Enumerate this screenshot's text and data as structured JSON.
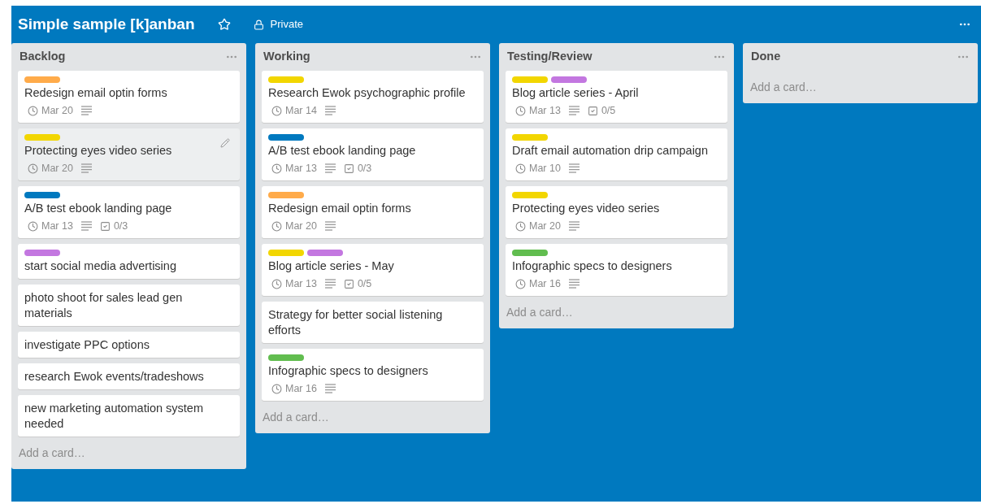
{
  "board": {
    "title": "Simple sample [k]anban",
    "starred": false,
    "visibility": "Private"
  },
  "lists": [
    {
      "name": "Backlog",
      "add_card": "Add a card…",
      "cards": [
        {
          "labels": [
            {
              "color": "#ffab4a"
            }
          ],
          "title": "Redesign email optin forms",
          "due": "Mar 20",
          "description": true,
          "hovered": false
        },
        {
          "labels": [
            {
              "color": "#f2d600"
            }
          ],
          "title": "Protecting eyes video series",
          "due": "Mar 20",
          "description": true,
          "hovered": true
        },
        {
          "labels": [
            {
              "color": "#0079bf"
            }
          ],
          "title": "A/B test ebook landing page",
          "due": "Mar 13",
          "description": true,
          "checklist": "0/3",
          "hovered": false
        },
        {
          "labels": [
            {
              "color": "#c377e0"
            }
          ],
          "title": "start social media advertising",
          "hovered": false
        },
        {
          "title": "photo shoot for sales lead gen materials",
          "hovered": false
        },
        {
          "title": "investigate PPC options",
          "hovered": false
        },
        {
          "title": "research Ewok events/tradeshows",
          "hovered": false
        },
        {
          "title": "new marketing automation system needed",
          "hovered": false
        }
      ]
    },
    {
      "name": "Working",
      "add_card": "Add a card…",
      "cards": [
        {
          "labels": [
            {
              "color": "#f2d600"
            }
          ],
          "title": "Research Ewok psychographic profile",
          "due": "Mar 14",
          "description": true,
          "hovered": false
        },
        {
          "labels": [
            {
              "color": "#0079bf"
            }
          ],
          "title": "A/B test ebook landing page",
          "due": "Mar 13",
          "description": true,
          "checklist": "0/3",
          "hovered": false
        },
        {
          "labels": [
            {
              "color": "#ffab4a"
            }
          ],
          "title": "Redesign email optin forms",
          "due": "Mar 20",
          "description": true,
          "hovered": false
        },
        {
          "labels": [
            {
              "color": "#f2d600"
            },
            {
              "color": "#c377e0"
            }
          ],
          "title": "Blog article series - May",
          "due": "Mar 13",
          "description": true,
          "checklist": "0/5",
          "hovered": false
        },
        {
          "title": "Strategy for better social listening efforts",
          "hovered": false
        },
        {
          "labels": [
            {
              "color": "#61bd4f"
            }
          ],
          "title": "Infographic specs to designers",
          "due": "Mar 16",
          "description": true,
          "hovered": false
        }
      ]
    },
    {
      "name": "Testing/Review",
      "add_card": "Add a card…",
      "cards": [
        {
          "labels": [
            {
              "color": "#f2d600"
            },
            {
              "color": "#c377e0"
            }
          ],
          "title": "Blog article series - April",
          "due": "Mar 13",
          "description": true,
          "checklist": "0/5",
          "hovered": false
        },
        {
          "labels": [
            {
              "color": "#f2d600"
            }
          ],
          "title": "Draft email automation drip campaign",
          "due": "Mar 10",
          "description": true,
          "hovered": false
        },
        {
          "labels": [
            {
              "color": "#f2d600"
            }
          ],
          "title": "Protecting eyes video series",
          "due": "Mar 20",
          "description": true,
          "hovered": false
        },
        {
          "labels": [
            {
              "color": "#61bd4f"
            }
          ],
          "title": "Infographic specs to designers",
          "due": "Mar 16",
          "description": true,
          "hovered": false
        }
      ]
    },
    {
      "name": "Done",
      "add_card": "Add a card…"
    }
  ]
}
